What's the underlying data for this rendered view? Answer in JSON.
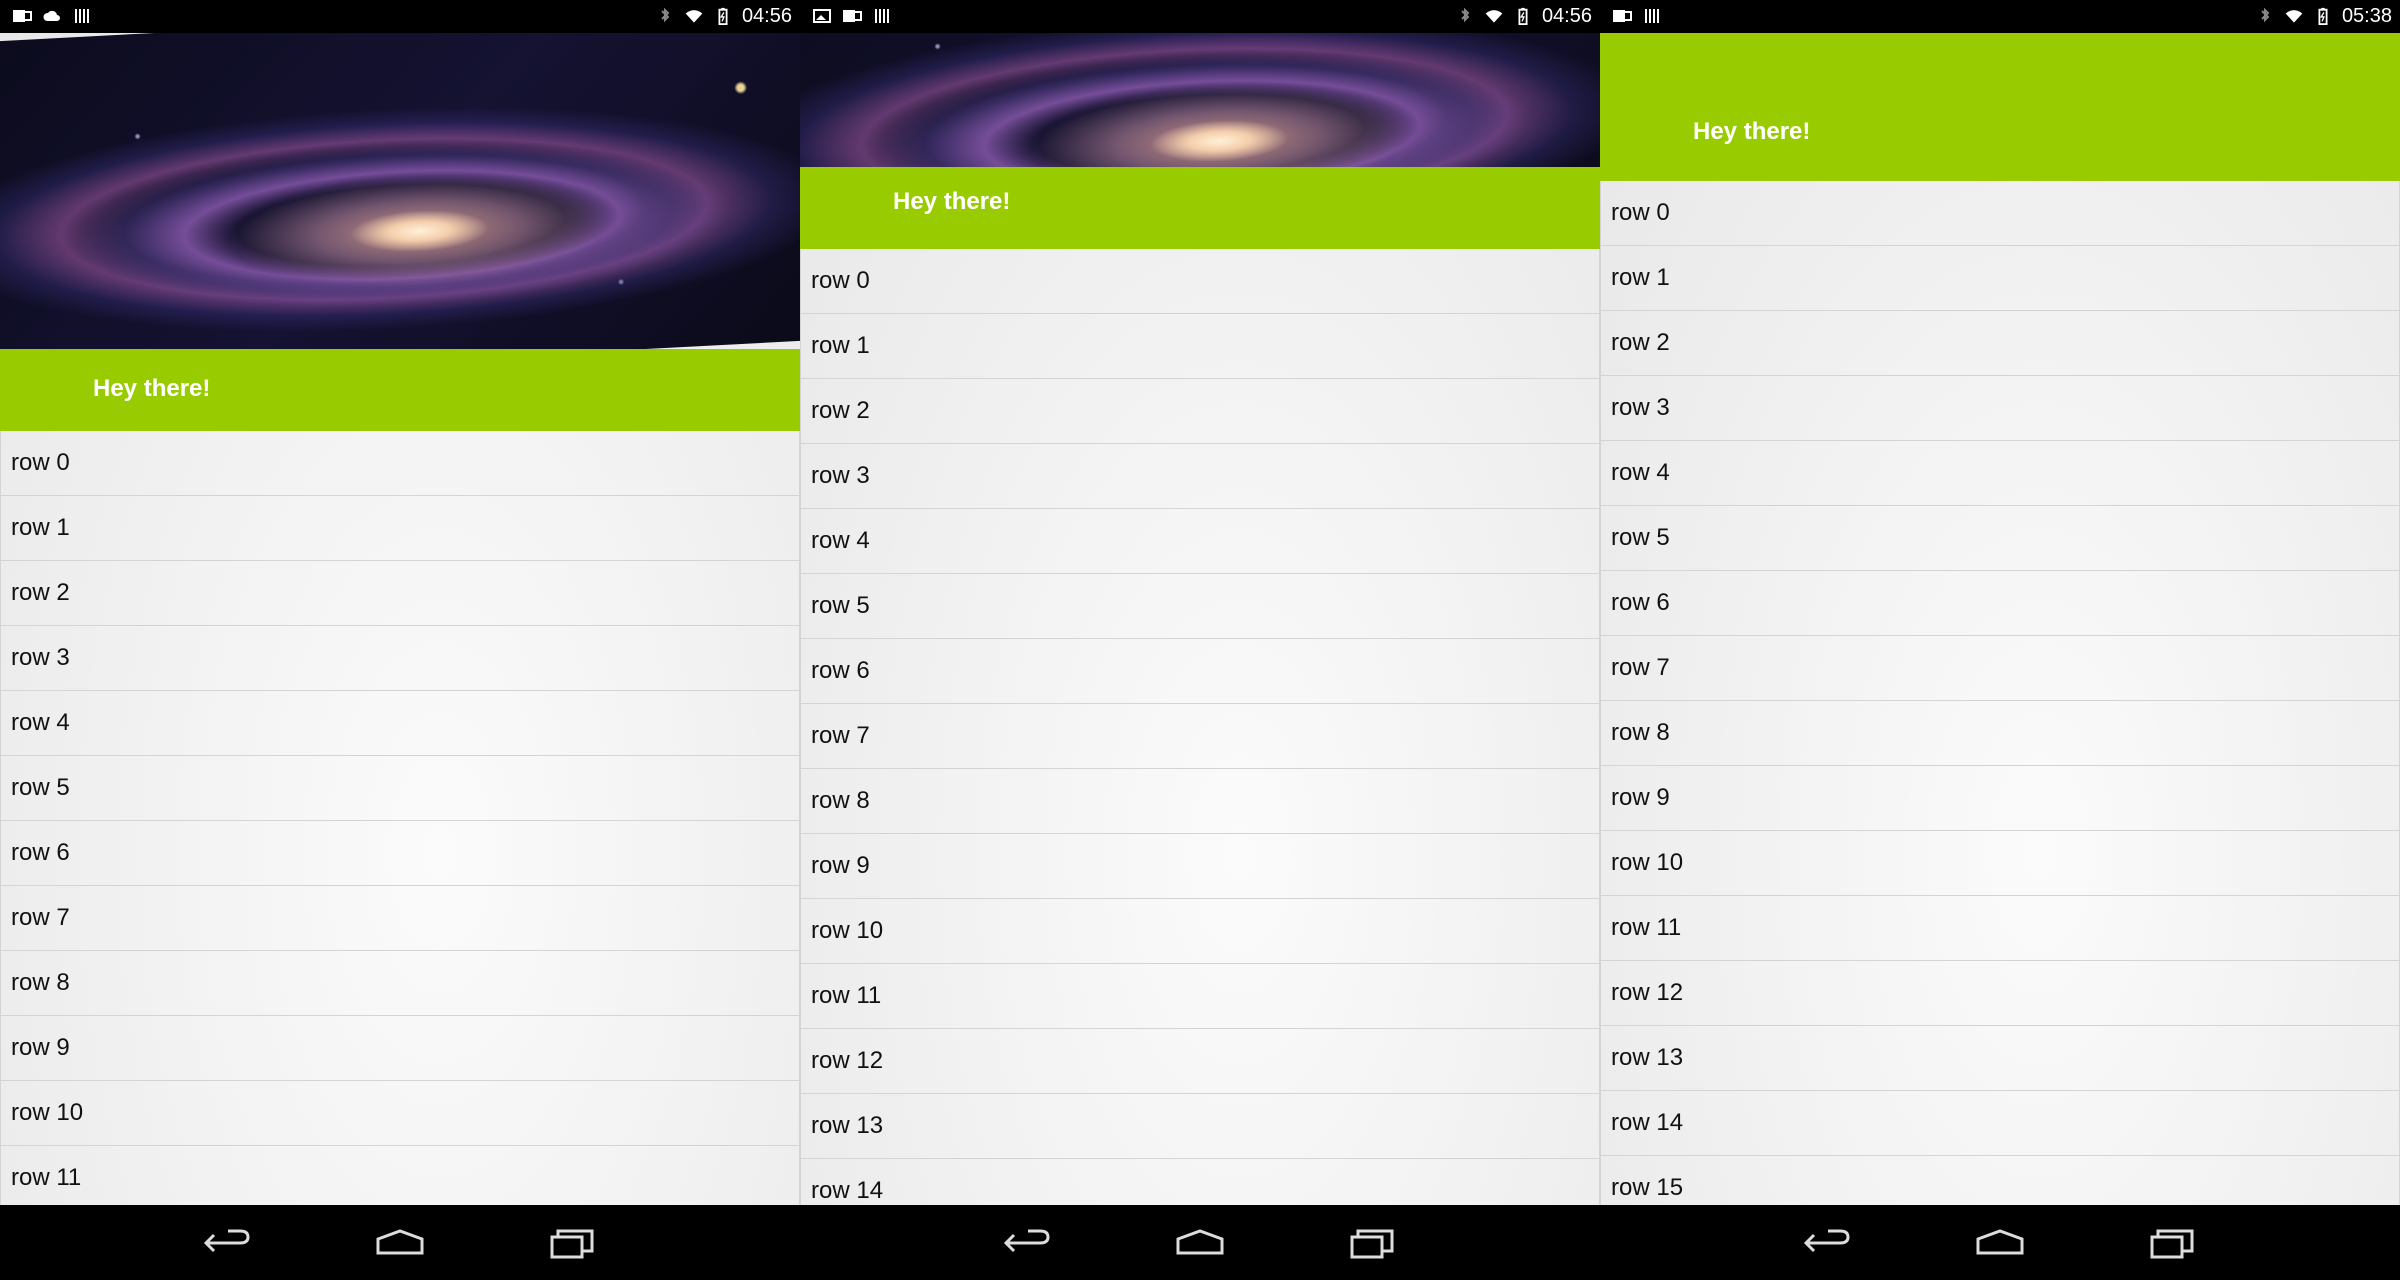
{
  "screens": [
    {
      "status": {
        "time": "04:56"
      },
      "banner": {
        "text": "Hey there!"
      },
      "rows": [
        "row 0",
        "row 1",
        "row 2",
        "row 3",
        "row 4",
        "row 5",
        "row 6",
        "row 7",
        "row 8",
        "row 9",
        "row 10",
        "row 11"
      ]
    },
    {
      "status": {
        "time": "04:56"
      },
      "banner": {
        "text": "Hey there!"
      },
      "rows": [
        "row 0",
        "row 1",
        "row 2",
        "row 3",
        "row 4",
        "row 5",
        "row 6",
        "row 7",
        "row 8",
        "row 9",
        "row 10",
        "row 11",
        "row 12",
        "row 13",
        "row 14"
      ]
    },
    {
      "status": {
        "time": "05:38"
      },
      "banner": {
        "text": "Hey there!"
      },
      "rows": [
        "row 0",
        "row 1",
        "row 2",
        "row 3",
        "row 4",
        "row 5",
        "row 6",
        "row 7",
        "row 8",
        "row 9",
        "row 10",
        "row 11",
        "row 12",
        "row 13",
        "row 14",
        "row 15"
      ]
    }
  ],
  "colors": {
    "accent": "#99cc00",
    "statusbar": "#000000",
    "text": "#111111"
  },
  "icons": [
    "notification-icon",
    "cloud-icon",
    "barcode-icon",
    "image-icon",
    "bluetooth-icon",
    "wifi-icon",
    "battery-icon",
    "back-icon",
    "home-icon",
    "recents-icon"
  ]
}
